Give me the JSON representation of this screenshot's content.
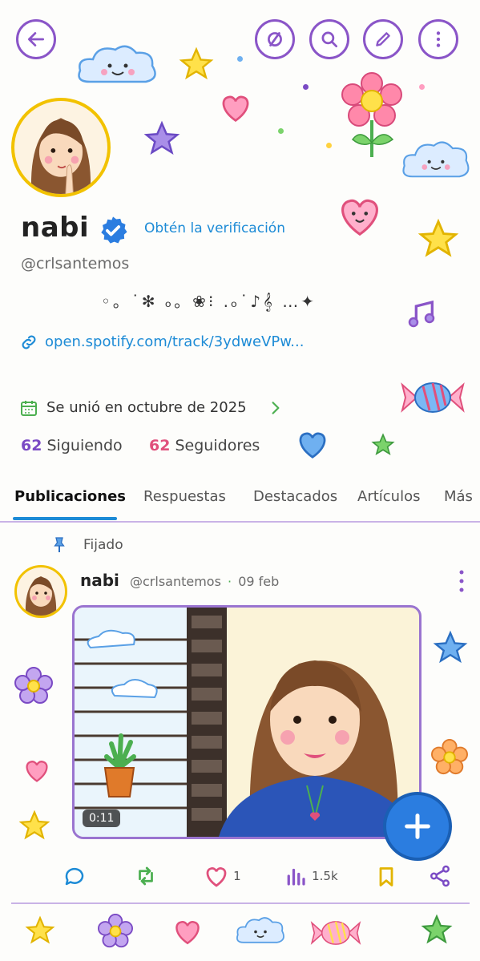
{
  "header": {
    "back_icon": "back-arrow-icon",
    "hide_icon": "eye-off-icon",
    "search_icon": "search-icon",
    "edit_icon": "pencil-icon",
    "more_icon": "more-vertical-icon"
  },
  "profile": {
    "display_name": "nabi",
    "verify_label": "Obtén la verificación",
    "handle": "@crlsantemos",
    "bio": "◦。˙✻ ₒ。❀⁝ .ₒ˙♪𝄞 …✦",
    "link": "open.spotify.com/track/3ydweVPw...",
    "joined": "Se unió en octubre de 2025",
    "following_count": "62",
    "following_label": "Siguiendo",
    "followers_count": "62",
    "followers_label": "Seguidores"
  },
  "tabs": [
    {
      "label": "Publicaciones",
      "active": true
    },
    {
      "label": "Respuestas",
      "active": false
    },
    {
      "label": "Destacados",
      "active": false
    },
    {
      "label": "Artículos",
      "active": false
    },
    {
      "label": "Más",
      "active": false
    }
  ],
  "post": {
    "pinned_label": "Fijado",
    "author": "nabi",
    "handle": "@crlsantemos",
    "separator": "·",
    "date": "09 feb",
    "video_duration": "0:11",
    "actions": {
      "reply_count": "",
      "repost_count": "",
      "like_count": "1",
      "views_count": "1.5k"
    }
  },
  "colors": {
    "accent_blue": "#1d8bd6",
    "accent_purple": "#8a55c8",
    "accent_pink": "#e0507c",
    "verified_blue": "#2b7de0"
  }
}
